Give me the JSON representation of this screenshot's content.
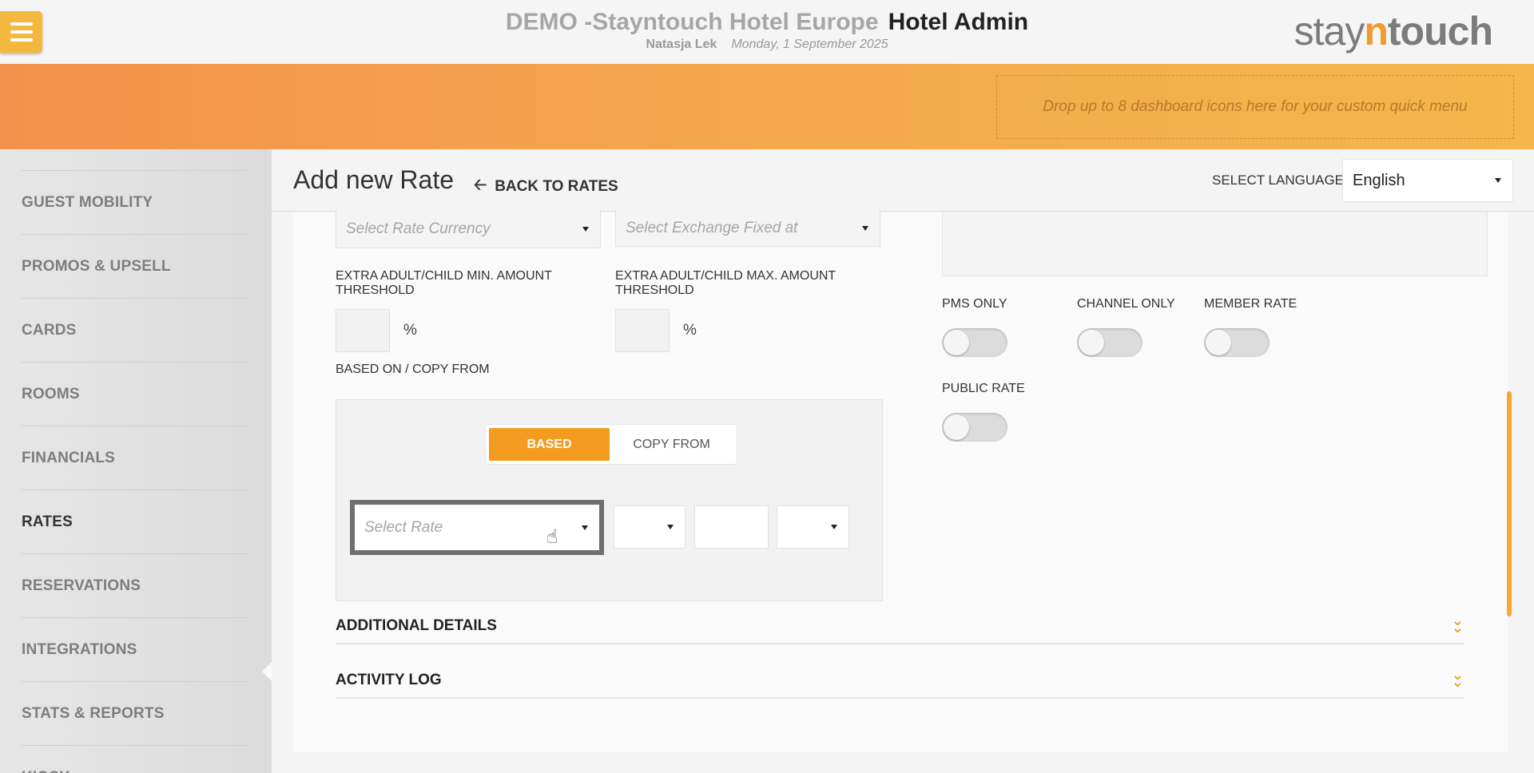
{
  "header": {
    "hotel_name": "DEMO -Stayntouch Hotel Europe",
    "app_name": "Hotel Admin",
    "user_name": "Natasja Lek",
    "date": "Monday, 1 September 2025",
    "logo": {
      "part1": "stay",
      "part2": "n",
      "part3": "touch"
    },
    "menu_icon": "hamburger-icon"
  },
  "quick_menu": {
    "placeholder": "Drop up to 8 dashboard icons here for your custom quick menu"
  },
  "sidebar": {
    "items": [
      {
        "label": "GUEST MOBILITY"
      },
      {
        "label": "PROMOS & UPSELL"
      },
      {
        "label": "CARDS"
      },
      {
        "label": "ROOMS"
      },
      {
        "label": "FINANCIALS"
      },
      {
        "label": "RATES",
        "active": true
      },
      {
        "label": "RESERVATIONS"
      },
      {
        "label": "INTEGRATIONS"
      },
      {
        "label": "STATS & REPORTS"
      },
      {
        "label": "KIOSK"
      }
    ]
  },
  "page": {
    "title": "Add new Rate",
    "back_label": "BACK TO RATES",
    "language_label": "SELECT LANGUAGE",
    "language_value": "English"
  },
  "form": {
    "rate_currency_placeholder": "Select Rate Currency",
    "exchange_fixed_placeholder": "Select Exchange Fixed at",
    "min_threshold_label": "EXTRA ADULT/CHILD MIN. AMOUNT THRESHOLD",
    "max_threshold_label": "EXTRA ADULT/CHILD MAX. AMOUNT THRESHOLD",
    "percent_sign": "%",
    "based_on_label": "BASED ON / COPY FROM",
    "segment_based": "BASED",
    "segment_copy": "COPY FROM",
    "select_rate_placeholder": "Select Rate",
    "toggles": {
      "pms_only": "PMS ONLY",
      "channel_only": "CHANNEL ONLY",
      "member_rate": "MEMBER RATE",
      "public_rate": "PUBLIC RATE"
    }
  },
  "sections": {
    "additional_details": "ADDITIONAL DETAILS",
    "activity_log": "ACTIVITY LOG"
  },
  "colors": {
    "accent": "#f39c1f",
    "band_start": "#f3924c",
    "band_end": "#f4b64d"
  }
}
